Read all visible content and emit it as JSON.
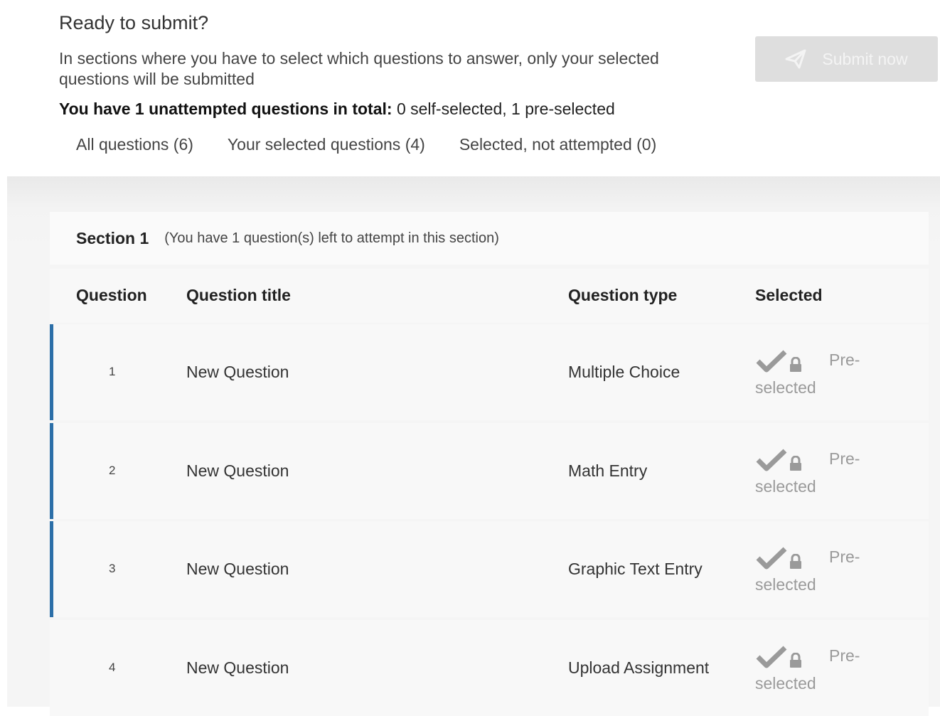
{
  "header": {
    "title": "Ready to submit?",
    "info": "In sections where you have to select which questions to answer, only your selected questions will be submitted",
    "summary_bold": "You have 1 unattempted questions in total:",
    "summary_rest": " 0 self-selected, 1 pre-selected",
    "submit_label": "Submit now"
  },
  "tabs": [
    {
      "label": "All questions (6)"
    },
    {
      "label": "Your selected questions (4)"
    },
    {
      "label": "Selected, not attempted (0)"
    }
  ],
  "section": {
    "name": "Section 1",
    "note": "(You have 1 question(s) left to attempt in this section)"
  },
  "table": {
    "headers": {
      "question": "Question",
      "title": "Question title",
      "type": "Question type",
      "selected": "Selected"
    },
    "rows": [
      {
        "num": "1",
        "title": "New Question",
        "type": "Multiple Choice",
        "pre": "Pre-",
        "selected": "selected"
      },
      {
        "num": "2",
        "title": "New Question",
        "type": "Math Entry",
        "pre": "Pre-",
        "selected": "selected"
      },
      {
        "num": "3",
        "title": "New Question",
        "type": "Graphic Text Entry",
        "pre": "Pre-",
        "selected": "selected"
      },
      {
        "num": "4",
        "title": "New Question",
        "type": "Upload Assignment",
        "pre": "Pre-",
        "selected": "selected"
      }
    ]
  },
  "colors": {
    "accent": "#2c6fa8",
    "disabled_button": "#dedede",
    "muted_text": "#9a9a9a"
  },
  "icons": {
    "submit": "paper-plane-icon",
    "selected": "checkmark-icon",
    "locked": "lock-icon"
  }
}
